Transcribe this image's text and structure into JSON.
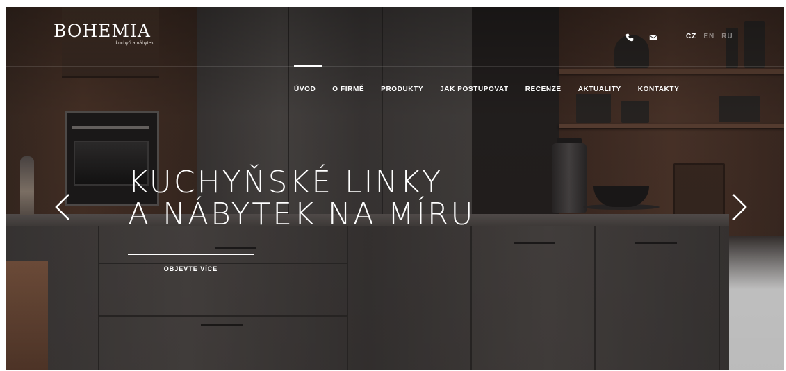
{
  "brand": {
    "name": "BOHEMIA",
    "tagline": "kuchyň a nábytek"
  },
  "header": {
    "icons": [
      "phone-icon",
      "mail-icon"
    ],
    "languages": [
      {
        "code": "CZ",
        "active": true
      },
      {
        "code": "EN",
        "active": false
      },
      {
        "code": "RU",
        "active": false
      }
    ]
  },
  "nav": {
    "items": [
      {
        "label": "ÚVOD",
        "active": true
      },
      {
        "label": "O FIRMĚ",
        "active": false
      },
      {
        "label": "PRODUKTY",
        "active": false
      },
      {
        "label": "JAK POSTUPOVAT",
        "active": false
      },
      {
        "label": "RECENZE",
        "active": false
      },
      {
        "label": "AKTUALITY",
        "active": false
      },
      {
        "label": "KONTAKTY",
        "active": false
      }
    ]
  },
  "hero": {
    "title_line1": "KUCHYŇSKÉ LINKY",
    "title_line2": "A NÁBYTEK NA MÍRU",
    "cta_label": "OBJEVTE VÍCE"
  },
  "carousel": {
    "prev_icon": "chevron-left-icon",
    "next_icon": "chevron-right-icon"
  },
  "colors": {
    "text": "#ffffff",
    "background": "#2a2625"
  }
}
